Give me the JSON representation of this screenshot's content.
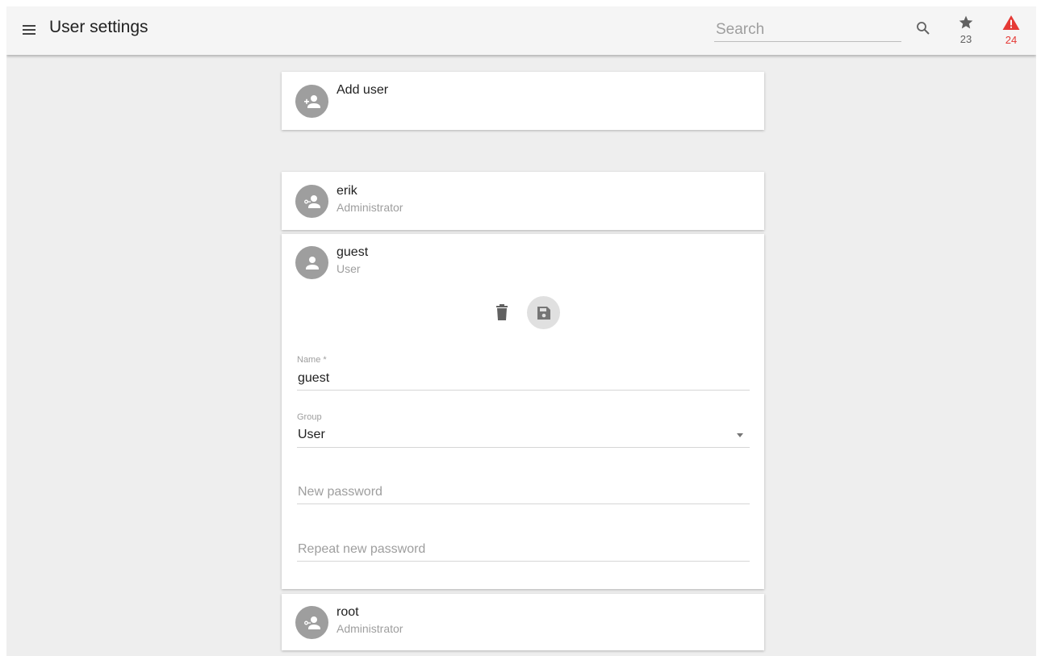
{
  "header": {
    "title": "User settings",
    "search_placeholder": "Search",
    "starred_count": "23",
    "alerts_count": "24"
  },
  "add_user": {
    "label": "Add user"
  },
  "users": [
    {
      "name": "erik",
      "group": "Administrator"
    },
    {
      "name": "guest",
      "group": "User"
    },
    {
      "name": "root",
      "group": "Administrator"
    }
  ],
  "edit_form": {
    "name_label": "Name *",
    "name_value": "guest",
    "group_label": "Group",
    "group_value": "User",
    "new_password_placeholder": "New password",
    "repeat_password_placeholder": "Repeat new password"
  },
  "colors": {
    "accent_alert": "#e53935",
    "avatar_bg": "#9e9e9e",
    "background": "#eeeeee"
  },
  "icons": {
    "menu": "menu-icon",
    "search": "search-icon",
    "star": "star-icon",
    "alert": "warning-icon",
    "add_user": "person-add-icon",
    "admin_user": "admin-user-icon",
    "user": "person-icon",
    "delete": "trash-icon",
    "save": "save-icon"
  }
}
